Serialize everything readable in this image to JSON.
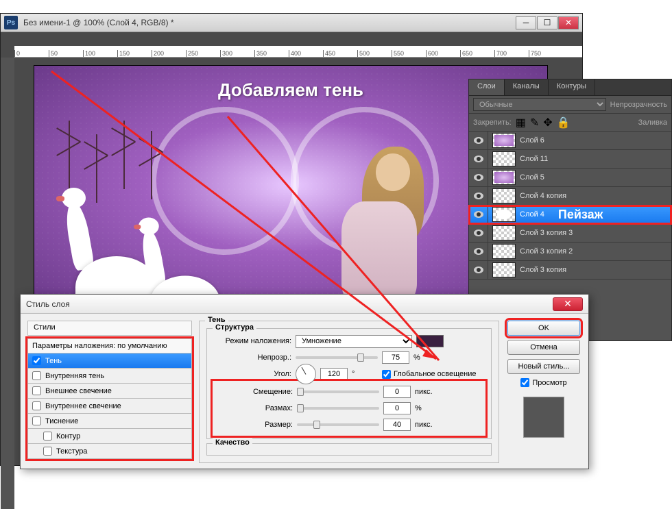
{
  "main_window": {
    "ps_label": "Ps",
    "title": "Без имени-1 @ 100% (Слой 4, RGB/8) *",
    "ruler_marks": [
      "0",
      "50",
      "100",
      "150",
      "200",
      "250",
      "300",
      "350",
      "400",
      "450",
      "500",
      "550",
      "600",
      "650",
      "700",
      "750"
    ]
  },
  "overlay": {
    "title": "Добавляем тень",
    "layer_annotation": "Пейзаж"
  },
  "layers_panel": {
    "tabs": [
      "Слои",
      "Каналы",
      "Контуры"
    ],
    "blend_mode": "Обычные",
    "opacity_label": "Непрозрачность",
    "lock_label": "Закрепить:",
    "fill_label": "Заливка",
    "layers": [
      {
        "name": "Слой 6",
        "thumb": "purple"
      },
      {
        "name": "Слой 11",
        "thumb": "checker"
      },
      {
        "name": "Слой 5",
        "thumb": "purple"
      },
      {
        "name": "Слой 4 копия",
        "thumb": "checker"
      },
      {
        "name": "Слой 4",
        "thumb": "white",
        "selected": true
      },
      {
        "name": "Слой 3 копия 3",
        "thumb": "checker"
      },
      {
        "name": "Слой 3 копия 2",
        "thumb": "checker"
      },
      {
        "name": "Слой 3 копия",
        "thumb": "checker"
      }
    ]
  },
  "dialog": {
    "title": "Стиль слоя",
    "styles_header": "Стили",
    "styles": [
      {
        "label": "Параметры наложения: по умолчанию",
        "default": true
      },
      {
        "label": "Тень",
        "checked": true,
        "selected": true
      },
      {
        "label": "Внутренняя тень",
        "checked": false
      },
      {
        "label": "Внешнее свечение",
        "checked": false
      },
      {
        "label": "Внутреннее свечение",
        "checked": false
      },
      {
        "label": "Тиснение",
        "checked": false
      },
      {
        "label": "Контур",
        "checked": false,
        "indent": true
      },
      {
        "label": "Текстура",
        "checked": false,
        "indent": true
      }
    ],
    "fieldset_title": "Тень",
    "structure_title": "Структура",
    "blend_label": "Режим наложения:",
    "blend_value": "Умножение",
    "opacity_label": "Непрозр.:",
    "opacity_value": "75",
    "opacity_unit": "%",
    "angle_label": "Угол:",
    "angle_value": "120",
    "angle_unit": "°",
    "global_light": "Глобальное освещение",
    "offset_label": "Смещение:",
    "offset_value": "0",
    "offset_unit": "пикс.",
    "spread_label": "Размах:",
    "spread_value": "0",
    "spread_unit": "%",
    "size_label": "Размер:",
    "size_value": "40",
    "size_unit": "пикс.",
    "quality_title": "Качество",
    "buttons": {
      "ok": "OK",
      "cancel": "Отмена",
      "new_style": "Новый стиль...",
      "preview": "Просмотр"
    }
  }
}
